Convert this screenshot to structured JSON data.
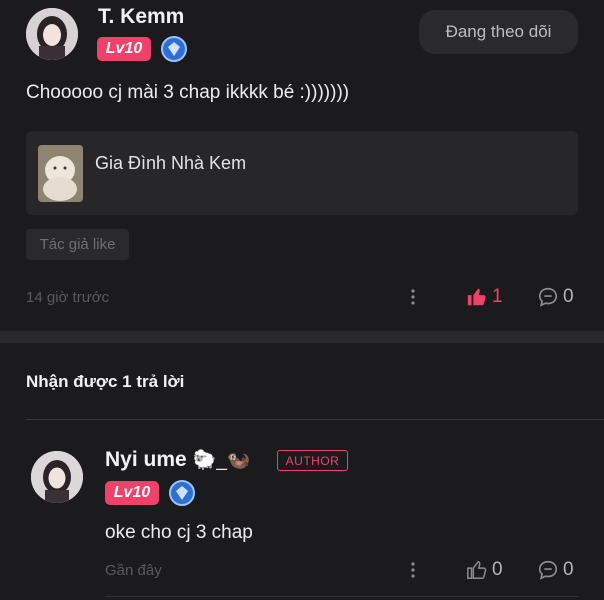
{
  "comment": {
    "username": "T. Kemm",
    "level": "Lv10",
    "follow_label": "Đang theo dõi",
    "text": "Chooooo cj mài 3 chap ikkkk bé :)))))))",
    "group_name": "Gia Đình Nhà Kem",
    "tag": "Tác giả like",
    "time": "14 giờ trước",
    "likes": "1",
    "replies": "0"
  },
  "section": {
    "title": "Nhận được 1 trả lời"
  },
  "reply": {
    "username": "Nyi ume",
    "emoji": "🐑_🦦",
    "author_label": "AUTHOR",
    "level": "Lv10",
    "text": "oke cho cj 3 chap",
    "time": "Gần đây",
    "likes": "0",
    "replies": "0"
  },
  "colors": {
    "accent": "#f0416a",
    "background": "#1b1b1d",
    "card": "#27272a"
  },
  "icons": [
    "shield-icon",
    "more-icon",
    "thumb-up-icon",
    "comment-icon"
  ]
}
